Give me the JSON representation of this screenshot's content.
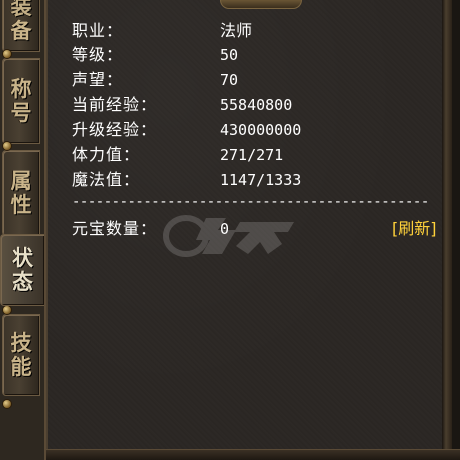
{
  "tabs": [
    {
      "id": "equipment",
      "label": "装备",
      "active": false
    },
    {
      "id": "title",
      "label": "称号",
      "active": false
    },
    {
      "id": "attributes",
      "label": "属性",
      "active": false
    },
    {
      "id": "status",
      "label": "状态",
      "active": true
    },
    {
      "id": "skills",
      "label": "技能",
      "active": false
    }
  ],
  "stats": {
    "profession": {
      "label": "职业：",
      "value": "法师"
    },
    "level": {
      "label": "等级：",
      "value": "50"
    },
    "reputation": {
      "label": "声望：",
      "value": "70"
    },
    "current_exp": {
      "label": "当前经验：",
      "value": "55840800"
    },
    "levelup_exp": {
      "label": "升级经验：",
      "value": "430000000"
    },
    "hp": {
      "label": "体力值：",
      "value": "271/271"
    },
    "mp": {
      "label": "魔法值：",
      "value": "1147/1333"
    }
  },
  "divider": "------------------------------------------------",
  "currency": {
    "label": "元宝数量：",
    "value": "0",
    "refresh_label": "[刷新]"
  },
  "colors": {
    "text": "#ffffff",
    "refresh": "#ffd23a",
    "tab_text": "#c9b48a",
    "panel_bg": "#2b2724"
  }
}
